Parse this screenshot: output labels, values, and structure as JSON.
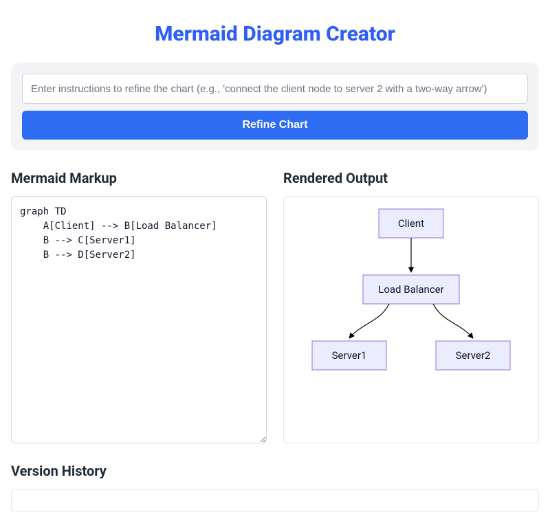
{
  "title": "Mermaid Diagram Creator",
  "refine": {
    "placeholder": "Enter instructions to refine the chart (e.g., 'connect the client node to server 2 with a two-way arrow')",
    "value": "",
    "button_label": "Refine Chart"
  },
  "markup_section": {
    "title": "Mermaid Markup",
    "code": "graph TD\n    A[Client] --> B[Load Balancer]\n    B --> C[Server1]\n    B --> D[Server2]"
  },
  "render_section": {
    "title": "Rendered Output",
    "diagram": {
      "type": "flowchart_td",
      "nodes": [
        {
          "id": "A",
          "label": "Client"
        },
        {
          "id": "B",
          "label": "Load Balancer"
        },
        {
          "id": "C",
          "label": "Server1"
        },
        {
          "id": "D",
          "label": "Server2"
        }
      ],
      "edges": [
        {
          "from": "A",
          "to": "B"
        },
        {
          "from": "B",
          "to": "C"
        },
        {
          "from": "B",
          "to": "D"
        }
      ]
    }
  },
  "history_section": {
    "title": "Version History",
    "entries": []
  }
}
